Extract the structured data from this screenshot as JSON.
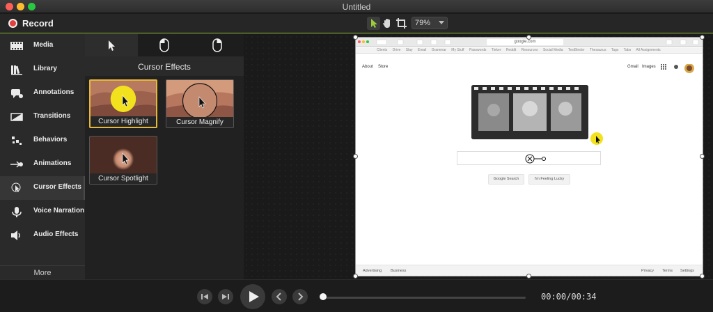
{
  "window": {
    "title": "Untitled"
  },
  "toolbar": {
    "record_label": "Record",
    "zoom_value": "79%",
    "tools": [
      "arrow-select-icon",
      "hand-pan-icon",
      "crop-icon"
    ]
  },
  "sidebar": {
    "items": [
      {
        "label": "Media",
        "icon": "film-strip-icon"
      },
      {
        "label": "Library",
        "icon": "books-icon"
      },
      {
        "label": "Annotations",
        "icon": "annotation-icon"
      },
      {
        "label": "Transitions",
        "icon": "transition-icon"
      },
      {
        "label": "Behaviors",
        "icon": "behaviors-icon"
      },
      {
        "label": "Animations",
        "icon": "animation-icon"
      },
      {
        "label": "Cursor Effects",
        "icon": "cursor-effects-icon"
      },
      {
        "label": "Voice Narration",
        "icon": "microphone-icon"
      },
      {
        "label": "Audio Effects",
        "icon": "speaker-icon"
      }
    ],
    "active": "Cursor Effects",
    "more_label": "More"
  },
  "panel": {
    "tabs": [
      "cursor-icon",
      "mouse-left-click-icon",
      "mouse-right-click-icon"
    ],
    "title": "Cursor Effects",
    "cards": [
      {
        "label": "Cursor Highlight",
        "selected": true
      },
      {
        "label": "Cursor Magnify",
        "selected": false
      },
      {
        "label": "Cursor Spotlight",
        "selected": false
      }
    ]
  },
  "browser": {
    "url": "google.com",
    "bookmarks": [
      "Clients",
      "Drive",
      "Slay",
      "Email",
      "Grammar",
      "My Stuff",
      "Passwords",
      "Tinker",
      "Reddit",
      "Resources",
      "Social Media",
      "TestBinder",
      "Thesaurus",
      "Tags",
      "Tabs",
      "All Assignments"
    ],
    "top_left_links": [
      "About",
      "Store"
    ],
    "top_right_links": [
      "Gmail",
      "Images"
    ],
    "buttons": [
      "Google Search",
      "I'm Feeling Lucky"
    ],
    "footer_left": [
      "Advertising",
      "Business"
    ],
    "footer_right": [
      "Privacy",
      "Terms",
      "Settings"
    ]
  },
  "transport": {
    "time": "00:00/00:34",
    "progress": 0.0
  },
  "colors": {
    "accent_green": "#99c23a",
    "record_red": "#e2403b",
    "highlight_yellow": "#f2e21e",
    "selected_border": "#e6b83a"
  }
}
